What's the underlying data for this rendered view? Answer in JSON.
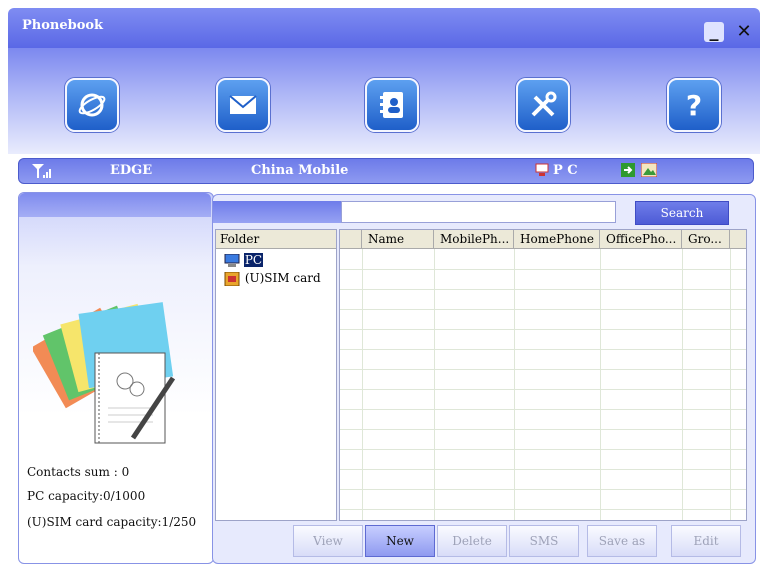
{
  "window": {
    "title": "Phonebook",
    "minimize": "_",
    "close": "✕"
  },
  "toolbar": {
    "icons": [
      "internet-icon",
      "message-icon",
      "phonebook-icon",
      "settings-icon",
      "help-icon"
    ],
    "help_glyph": "?"
  },
  "status": {
    "network": "EDGE",
    "operator": "China Mobile",
    "storage": "P C"
  },
  "left": {
    "contacts_sum": "Contacts sum : 0",
    "pc_capacity": "PC capacity:0/1000",
    "sim_capacity": "(U)SIM card capacity:1/250"
  },
  "search": {
    "value": "",
    "button": "Search"
  },
  "folder": {
    "header": "Folder",
    "items": [
      "PC",
      "(U)SIM card"
    ]
  },
  "table": {
    "columns": [
      "Name",
      "MobilePh...",
      "HomePhone",
      "OfficePho...",
      "Gro..."
    ]
  },
  "actions": [
    "View",
    "New",
    "Delete",
    "SMS",
    "Save as",
    "Edit"
  ],
  "colors": {
    "accent": "#5a68e6",
    "panel": "#e7eafd",
    "selected": "#0a246a"
  }
}
